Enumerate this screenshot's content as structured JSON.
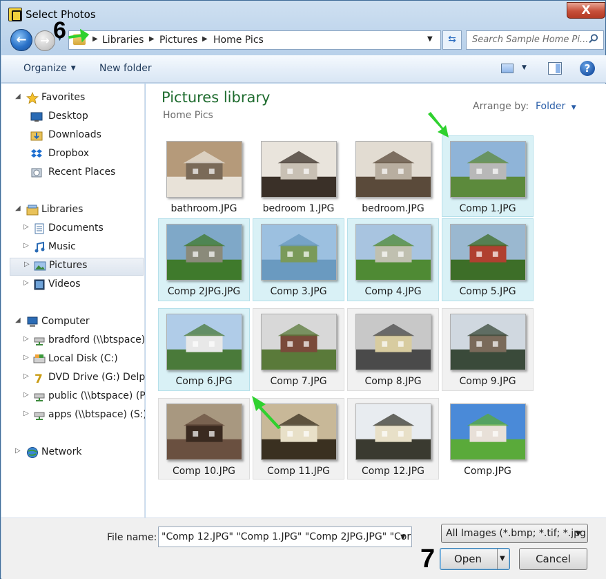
{
  "window": {
    "title": "Select Photos",
    "close_label": "X"
  },
  "annotations": {
    "step6": "6",
    "step7": "7"
  },
  "nav": {
    "breadcrumbs": [
      "Libraries",
      "Pictures",
      "Home Pics"
    ],
    "search_placeholder": "Search Sample Home Pi..."
  },
  "toolbar": {
    "organize": "Organize",
    "new_folder": "New folder",
    "help": "?"
  },
  "sidebar": {
    "favorites": {
      "label": "Favorites",
      "items": [
        "Desktop",
        "Downloads",
        "Dropbox",
        "Recent Places"
      ]
    },
    "libraries": {
      "label": "Libraries",
      "items": [
        "Documents",
        "Music",
        "Pictures",
        "Videos"
      ],
      "selected": "Pictures"
    },
    "computer": {
      "label": "Computer",
      "items": [
        "bradford (\\\\btspace)",
        "Local Disk (C:)",
        "DVD Drive (G:) Delph",
        "public (\\\\btspace) (P:",
        "apps (\\\\btspace) (S:)"
      ]
    },
    "network": {
      "label": "Network"
    }
  },
  "library": {
    "title": "Pictures library",
    "subtitle": "Home Pics",
    "arrange_label": "Arrange by:",
    "arrange_value": "Folder"
  },
  "files": [
    {
      "name": "bathroom.JPG",
      "selected": false
    },
    {
      "name": "bedroom 1.JPG",
      "selected": false
    },
    {
      "name": "bedroom.JPG",
      "selected": false
    },
    {
      "name": "Comp 1.JPG",
      "selected": true
    },
    {
      "name": "Comp 2JPG.JPG",
      "selected": true
    },
    {
      "name": "Comp 3.JPG",
      "selected": true
    },
    {
      "name": "Comp 4.JPG",
      "selected": true
    },
    {
      "name": "Comp 5.JPG",
      "selected": true
    },
    {
      "name": "Comp 6.JPG",
      "selected": true
    },
    {
      "name": "Comp 7.JPG",
      "selected": false
    },
    {
      "name": "Comp 8.JPG",
      "selected": false
    },
    {
      "name": "Comp 9.JPG",
      "selected": false
    },
    {
      "name": "Comp 10.JPG",
      "selected": false
    },
    {
      "name": "Comp 11.JPG",
      "selected": false
    },
    {
      "name": "Comp 12.JPG",
      "selected": false
    },
    {
      "name": "Comp.JPG",
      "selected": false
    }
  ],
  "footer": {
    "file_name_label": "File name:",
    "file_name_value": "\"Comp 12.JPG\" \"Comp 1.JPG\" \"Comp 2JPG.JPG\" \"Cor",
    "filter_value": "All Images (*.bmp; *.tif; *.jpg",
    "open_label": "Open",
    "cancel_label": "Cancel"
  },
  "colors": {
    "accent": "#2a5ea8",
    "selection": "#d9f1f6",
    "library_title": "#1e6b2e",
    "annotation_arrow": "#2fd12f"
  }
}
